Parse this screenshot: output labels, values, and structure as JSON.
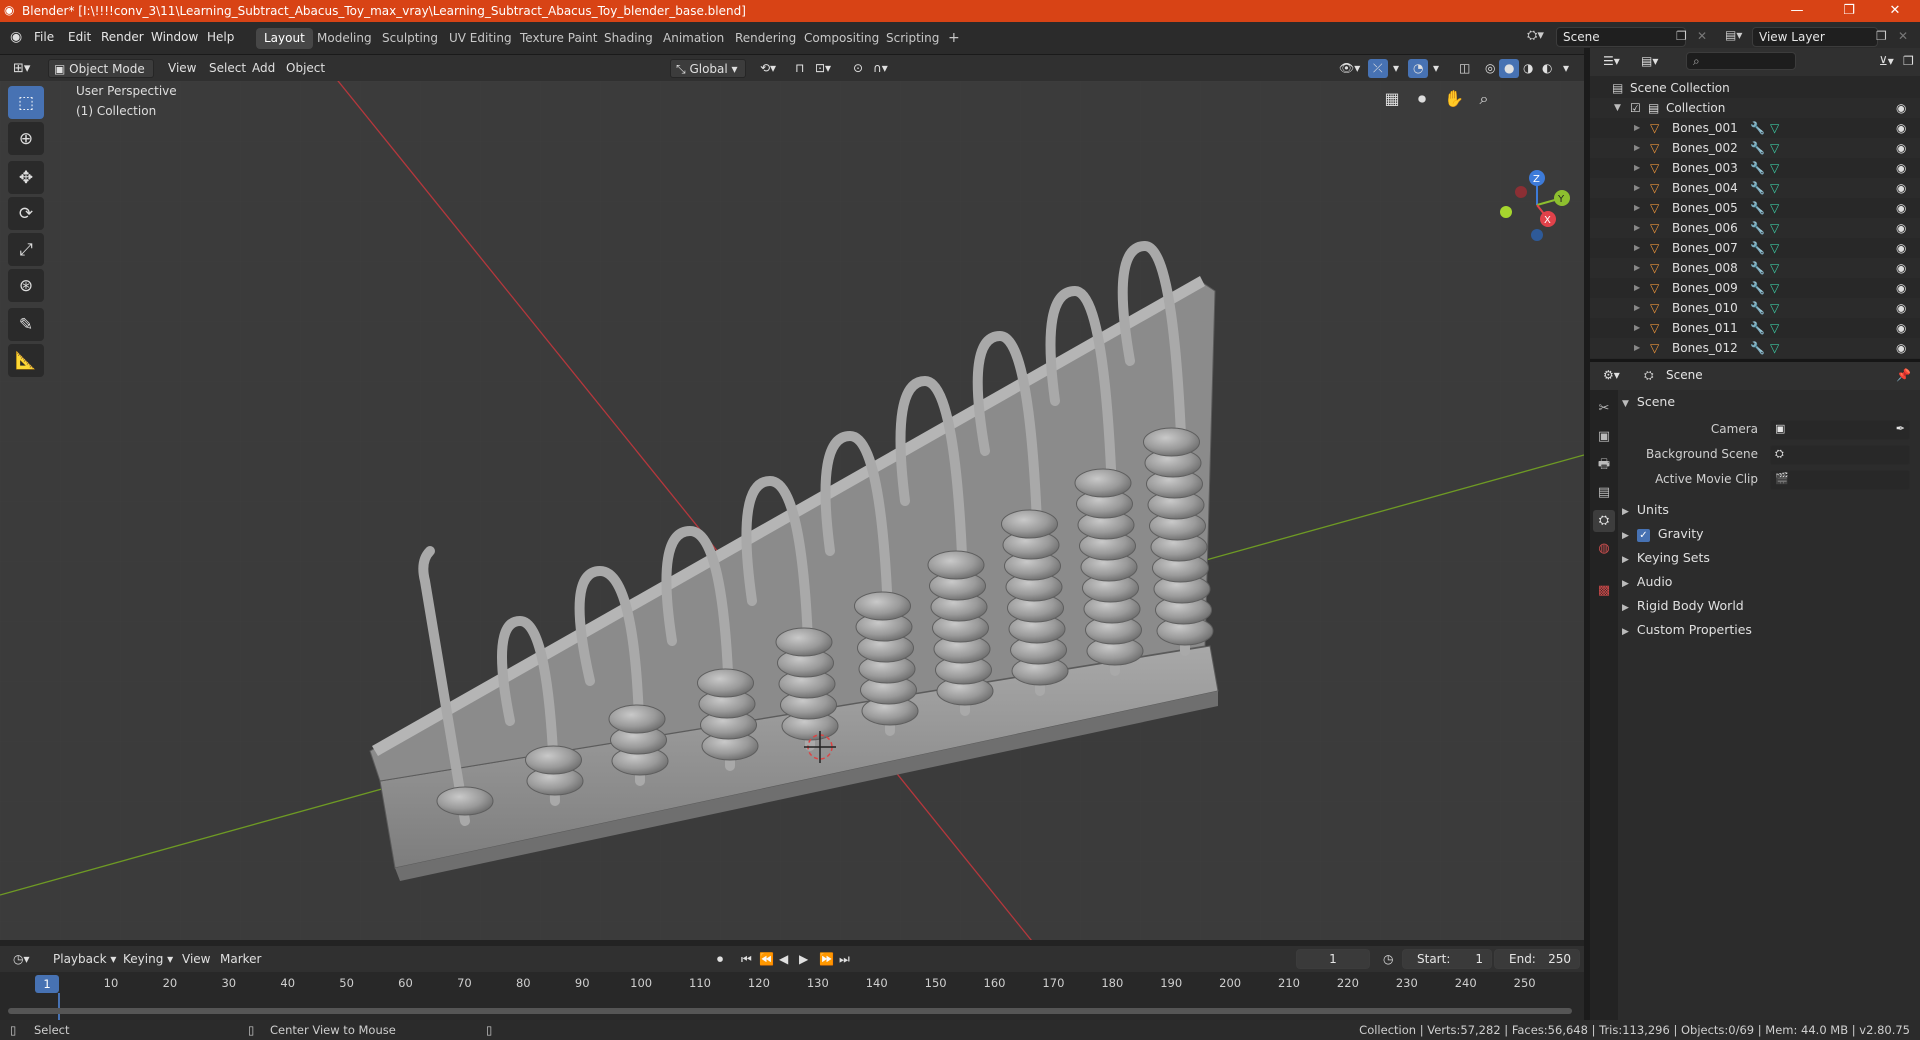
{
  "window": {
    "title": "Blender* [I:\\!!!!conv_3\\11\\Learning_Subtract_Abacus_Toy_max_vray\\Learning_Subtract_Abacus_Toy_blender_base.blend]",
    "minimize": "—",
    "maximize": "❐",
    "close": "✕"
  },
  "menus": [
    "File",
    "Edit",
    "Render",
    "Window",
    "Help"
  ],
  "workspaces": [
    "Layout",
    "Modeling",
    "Sculpting",
    "UV Editing",
    "Texture Paint",
    "Shading",
    "Animation",
    "Rendering",
    "Compositing",
    "Scripting"
  ],
  "active_workspace": "Layout",
  "add_workspace": "+",
  "scene_field": "Scene",
  "view_layer_field": "View Layer",
  "viewport_header": {
    "mode": "Object Mode",
    "menus": [
      "View",
      "Select",
      "Add",
      "Object"
    ],
    "orientation": "Global"
  },
  "viewport": {
    "perspective": "User Perspective",
    "collection": "(1) Collection",
    "gizmo": {
      "x": "X",
      "y": "Y",
      "z": "Z"
    }
  },
  "outliner": {
    "scene_collection": "Scene Collection",
    "collection": "Collection",
    "items": [
      "Bones_001",
      "Bones_002",
      "Bones_003",
      "Bones_004",
      "Bones_005",
      "Bones_006",
      "Bones_007",
      "Bones_008",
      "Bones_009",
      "Bones_010",
      "Bones_011",
      "Bones_012"
    ]
  },
  "properties": {
    "context": "Scene",
    "panel_title": "Scene",
    "camera_label": "Camera",
    "background_scene_label": "Background Scene",
    "active_movie_clip_label": "Active Movie Clip",
    "panels": [
      "Units",
      "Gravity",
      "Keying Sets",
      "Audio",
      "Rigid Body World",
      "Custom Properties"
    ],
    "gravity_checked": true
  },
  "timeline": {
    "menus": [
      "Playback",
      "Keying",
      "View",
      "Marker"
    ],
    "current_frame": "1",
    "start_label": "Start:",
    "start_value": "1",
    "end_label": "End:",
    "end_value": "250",
    "ticks": [
      "1",
      "10",
      "20",
      "30",
      "40",
      "50",
      "60",
      "70",
      "80",
      "90",
      "100",
      "110",
      "120",
      "130",
      "140",
      "150",
      "160",
      "170",
      "180",
      "190",
      "200",
      "210",
      "220",
      "230",
      "240",
      "250"
    ]
  },
  "statusbar": {
    "left": "Select",
    "middle": "Center View to Mouse",
    "right": "Collection | Verts:57,282 | Faces:56,648 | Tris:113,296 | Objects:0/69 | Mem: 44.0 MB | v2.80.75"
  },
  "colors": {
    "titlebar": "#d84315",
    "accent": "#4772b3",
    "x_axis": "#e0424a",
    "y_axis": "#8dbf2f",
    "z_axis": "#3d7bd9"
  }
}
